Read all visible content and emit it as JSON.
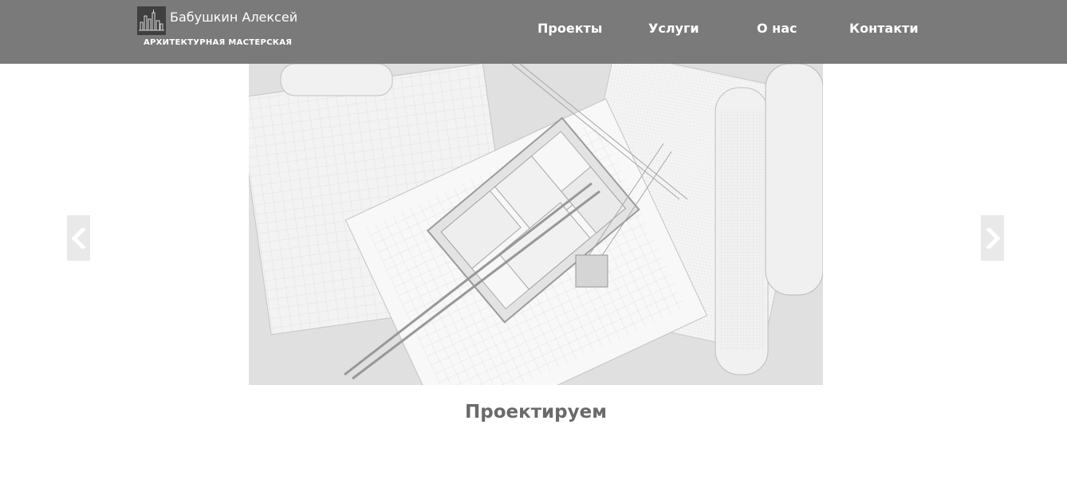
{
  "brand": {
    "name": "Бабушкин Алексей",
    "subtitle": "АРХИТЕКТУРНАЯ МАСТЕРСКАЯ"
  },
  "nav": {
    "items": [
      {
        "label": "Проекты"
      },
      {
        "label": "Услуги"
      },
      {
        "label": "О нас"
      },
      {
        "label": "Контакти"
      }
    ]
  },
  "slider": {
    "caption": "Проектируем",
    "image": "architectural-blueprints-3d-model-crane",
    "prev_icon": "chevron-left-icon",
    "next_icon": "chevron-right-icon"
  },
  "colors": {
    "header_bg": "#7a7a7a",
    "caption_text": "#6a6a6a",
    "arrow_bg": "#e9e9e9"
  }
}
